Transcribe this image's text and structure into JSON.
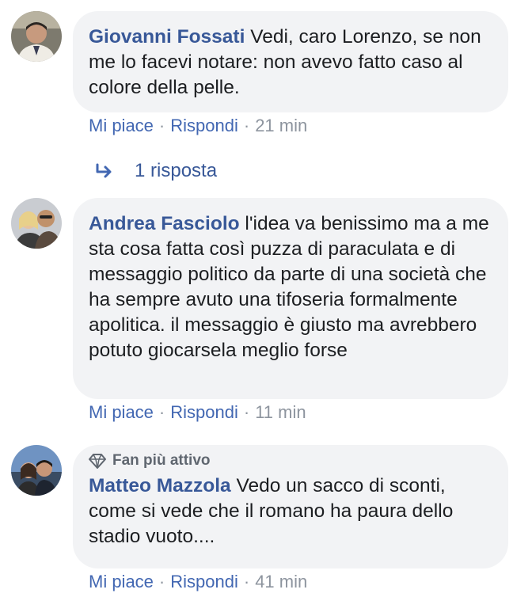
{
  "comments": [
    {
      "author": "Giovanni Fossati",
      "text": "Vedi, caro Lorenzo, se non me lo facevi notare: non avevo fatto caso al colore della pelle.",
      "like": "Mi piace",
      "reply": "Rispondi",
      "dot": "·",
      "time": "21 min"
    },
    {
      "author": "Andrea Fasciolo",
      "text": "l'idea va benissimo ma a me sta cosa fatta così puzza di paraculata e di messaggio politico da parte di una società che ha sempre avuto una tifoseria formalmente apolitica. il messaggio è giusto ma avrebbero potuto giocarsela meglio forse",
      "like": "Mi piace",
      "reply": "Rispondi",
      "dot": "·",
      "time": "11 min"
    },
    {
      "badge": "Fan più attivo",
      "badge_icon": "diamond-icon",
      "author": "Matteo Mazzola",
      "text": "Vedo un sacco di sconti, come si vede che il romano ha paura dello stadio vuoto....",
      "like": "Mi piace",
      "reply": "Rispondi",
      "dot": "·",
      "time": "41 min"
    }
  ],
  "replies_link": {
    "icon": "reply-arrow-icon",
    "label": "1 risposta"
  },
  "colors": {
    "author": "#385898",
    "link": "#4267b2",
    "muted": "#8d949e",
    "bubble": "#f2f3f5",
    "text": "#1c1e21"
  }
}
